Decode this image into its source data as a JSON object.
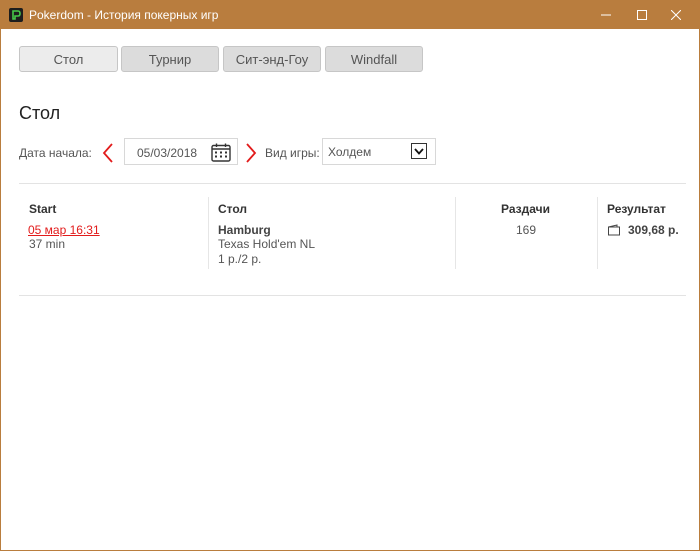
{
  "window": {
    "title": "Pokerdom - История покерных игр",
    "titlebar_color": "#b97d3e"
  },
  "tabs": [
    {
      "label": "Стол",
      "active": true
    },
    {
      "label": "Турнир",
      "active": false
    },
    {
      "label": "Сит-энд-Гоу",
      "active": false
    },
    {
      "label": "Windfall",
      "active": false
    }
  ],
  "page": {
    "title": "Стол"
  },
  "filters": {
    "start_date_label": "Дата начала:",
    "start_date_value": "05/03/2018",
    "game_type_label": "Вид игры:",
    "game_type_value": "Холдем"
  },
  "table": {
    "headers": {
      "start": "Start",
      "table": "Стол",
      "hands": "Раздачи",
      "result": "Результат"
    },
    "rows": [
      {
        "start": "05 мар 16:31",
        "duration": "37 min",
        "table_name": "Hamburg",
        "game_type": "Texas Hold'em NL",
        "stakes": "1 р./2 р.",
        "hands": "169",
        "result": "309,68 р."
      }
    ]
  },
  "colors": {
    "accent_red": "#e21b1b",
    "tab_bg": "#dcdcdc"
  },
  "icons": [
    "pokerdom-logo-icon",
    "minimize-icon",
    "maximize-icon",
    "close-icon",
    "chevron-left-icon",
    "chevron-right-icon",
    "calendar-icon",
    "dropdown-arrow-icon",
    "wallet-icon"
  ]
}
